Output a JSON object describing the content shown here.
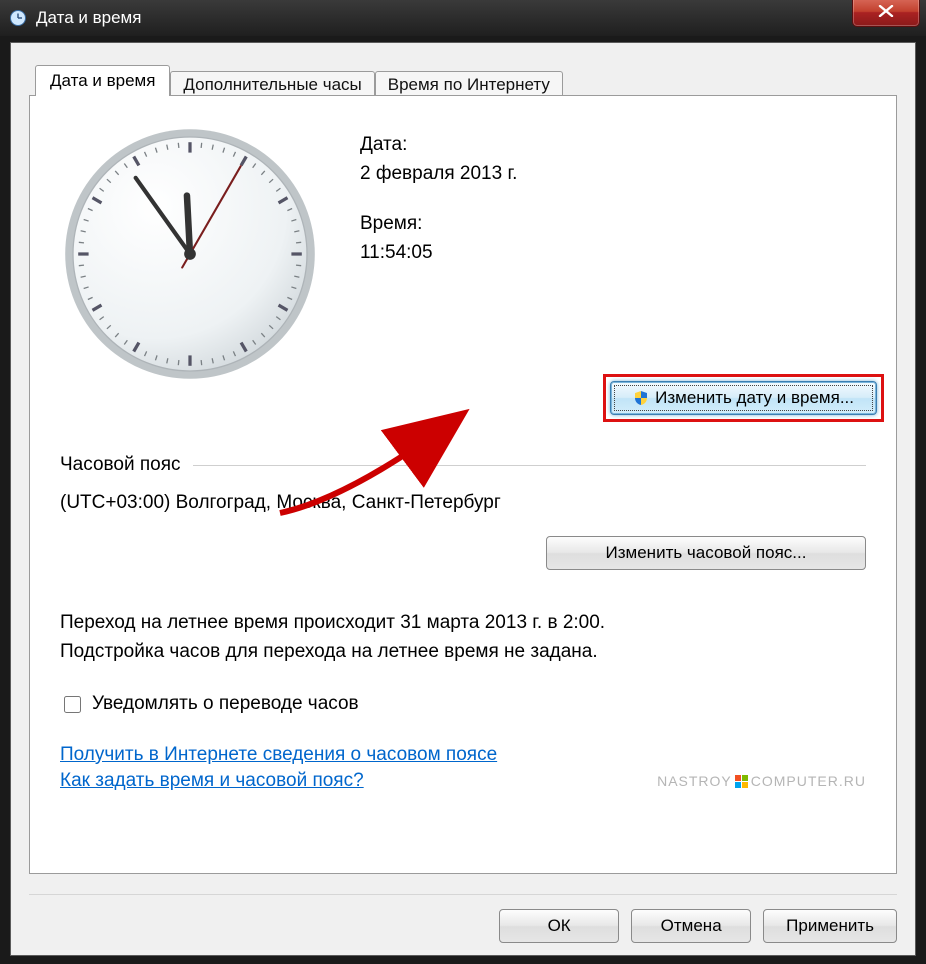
{
  "window": {
    "title": "Дата и время"
  },
  "tabs": [
    {
      "label": "Дата и время",
      "active": true
    },
    {
      "label": "Дополнительные часы",
      "active": false
    },
    {
      "label": "Время по Интернету",
      "active": false
    }
  ],
  "date_section": {
    "date_label": "Дата:",
    "date_value": "2 февраля 2013 г.",
    "time_label": "Время:",
    "time_value": "11:54:05"
  },
  "change_datetime_btn": "Изменить дату и время...",
  "timezone": {
    "heading": "Часовой пояс",
    "value": "(UTC+03:00) Волгоград, Москва, Санкт-Петербург",
    "change_btn": "Изменить часовой пояс..."
  },
  "dst": {
    "line1": "Переход на летнее время происходит 31 марта 2013 г. в 2:00.",
    "line2": "Подстройка часов для перехода на летнее время не задана."
  },
  "notify_checkbox": {
    "label": "Уведомлять о переводе часов",
    "checked": false
  },
  "links": {
    "tz_info": "Получить в Интернете сведения о часовом поясе",
    "howto": "Как задать время и часовой пояс?"
  },
  "watermark": {
    "left": "NASTROY",
    "right": "COMPUTER.RU"
  },
  "buttons": {
    "ok": "ОК",
    "cancel": "Отмена",
    "apply": "Применить"
  },
  "clock": {
    "hour": 11,
    "minute": 54,
    "second": 5
  },
  "annotation": {
    "highlight_color": "#d11",
    "arrow_color": "#cc0000"
  }
}
